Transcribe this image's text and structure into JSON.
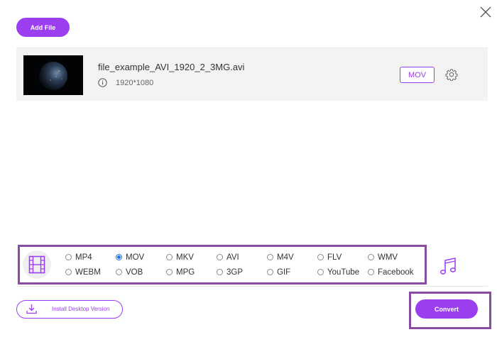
{
  "window": {
    "close_icon": "close-icon"
  },
  "toolbar": {
    "add_file_label": "Add File"
  },
  "file": {
    "name": "file_example_AVI_1920_2_3MG.avi",
    "resolution": "1920*1080",
    "output_format": "MOV",
    "thumbnail": "earth-at-night"
  },
  "formats": {
    "selected": "MOV",
    "options": [
      {
        "label": "MP4",
        "checked": false
      },
      {
        "label": "MOV",
        "checked": true
      },
      {
        "label": "MKV",
        "checked": false
      },
      {
        "label": "AVI",
        "checked": false
      },
      {
        "label": "M4V",
        "checked": false
      },
      {
        "label": "FLV",
        "checked": false
      },
      {
        "label": "WMV",
        "checked": false
      },
      {
        "label": "WEBM",
        "checked": false
      },
      {
        "label": "VOB",
        "checked": false
      },
      {
        "label": "MPG",
        "checked": false
      },
      {
        "label": "3GP",
        "checked": false
      },
      {
        "label": "GIF",
        "checked": false
      },
      {
        "label": "YouTube",
        "checked": false
      },
      {
        "label": "Facebook",
        "checked": false
      }
    ]
  },
  "footer": {
    "install_label": "Install Desktop Version",
    "convert_label": "Convert"
  },
  "colors": {
    "accent": "#9b3ef0",
    "highlight_frame": "#874da1",
    "radio_checked": "#1a73e8"
  }
}
